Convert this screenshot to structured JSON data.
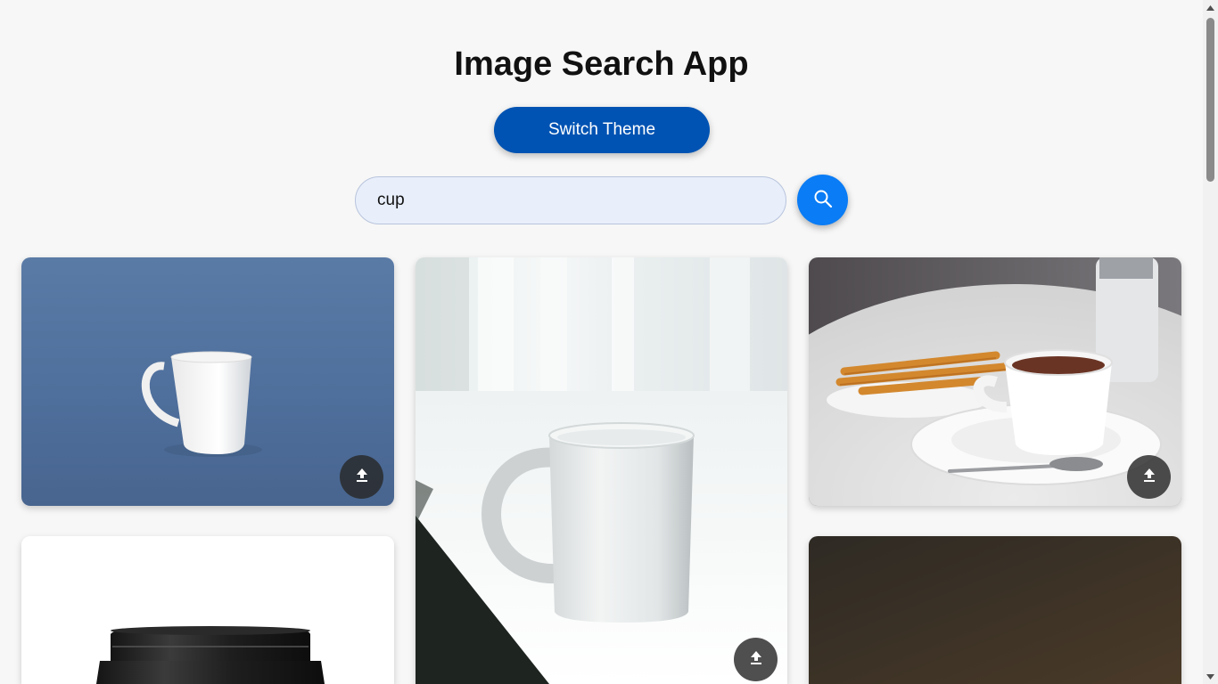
{
  "app": {
    "title": "Image Search App"
  },
  "toolbar": {
    "theme_button_label": "Switch Theme"
  },
  "search": {
    "query": "cup",
    "button_icon": "search-icon"
  },
  "results": [
    {
      "subject": "white mug on blue background",
      "action_icon": "download-icon"
    },
    {
      "subject": "white mug on windowsill",
      "action_icon": "download-icon"
    },
    {
      "subject": "hot chocolate with churros",
      "action_icon": "download-icon"
    },
    {
      "subject": "black cup lid on white",
      "action_icon": "download-icon"
    },
    {
      "subject": "dark brown background",
      "action_icon": "download-icon"
    }
  ],
  "colors": {
    "accent": "#0a7cf5",
    "theme_button": "#0153b3",
    "background": "#f7f7f7"
  }
}
